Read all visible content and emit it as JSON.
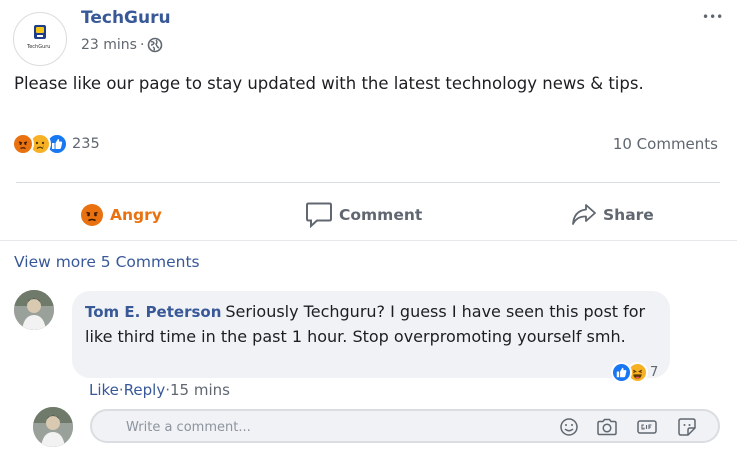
{
  "post": {
    "page_name": "TechGuru",
    "logo_text": "TechGuru",
    "time": "23 mins",
    "separator": "·",
    "text": "Please like our page to stay updated with the latest technology news & tips.",
    "reactions_count": "235",
    "comments_count": "10 Comments",
    "more_label": "•••"
  },
  "actions": {
    "react_label": "Angry",
    "comment_label": "Comment",
    "share_label": "Share"
  },
  "view_more": "View more 5 Comments",
  "comment": {
    "author": "Tom E. Peterson",
    "text": "Seriously Techguru? I guess I have seen this post for like third time in the past 1 hour. Stop overpromoting yourself smh.",
    "reaction_count": "7",
    "like": "Like",
    "reply": "Reply",
    "sep": "·",
    "time": "15 mins"
  },
  "composer": {
    "placeholder": "Write a comment..."
  },
  "icons": {
    "globe": "globe-icon",
    "more": "more-icon",
    "angry": "angry-reaction-icon",
    "sad": "sad-reaction-icon",
    "like": "like-reaction-icon",
    "haha": "haha-reaction-icon",
    "comment": "comment-icon",
    "share": "share-icon",
    "emoji": "emoji-icon",
    "camera": "camera-icon",
    "gif": "gif-icon",
    "sticker": "sticker-icon"
  },
  "colors": {
    "link": "#385898",
    "angry": "#e9710f",
    "like": "#1877f2",
    "sad": "#f7b125",
    "text_secondary": "#606770",
    "bubble": "#f0f2f5"
  }
}
